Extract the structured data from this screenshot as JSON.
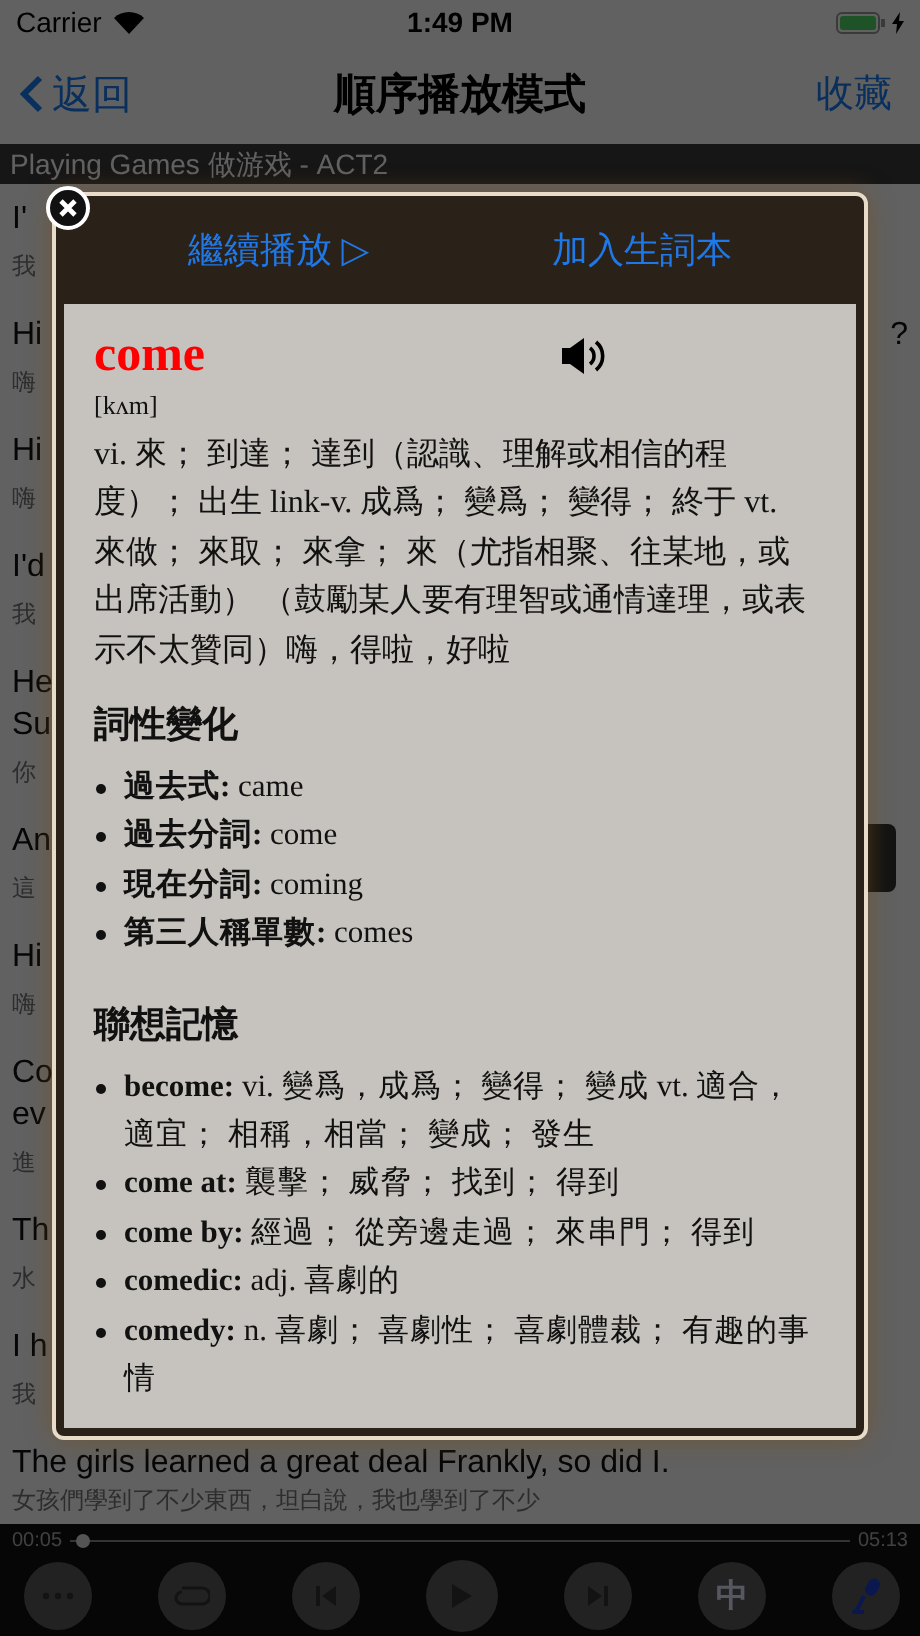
{
  "status_bar": {
    "carrier": "Carrier",
    "time": "1:49 PM"
  },
  "nav": {
    "back": "返回",
    "title": "順序播放模式",
    "action": "收藏"
  },
  "subtitle": "Playing Games 做游戏 - ACT2",
  "transcript": [
    {
      "lines": [
        "I'"
      ],
      "translation": "我"
    },
    {
      "lines": [
        "Hi"
      ],
      "translation": "嗨",
      "tail": "?"
    },
    {
      "lines": [
        "Hi"
      ],
      "translation": "嗨"
    },
    {
      "lines": [
        "I'd"
      ],
      "translation": "我"
    },
    {
      "lines": [
        "He",
        "Su"
      ],
      "translation": "你"
    },
    {
      "lines": [
        "An"
      ],
      "translation": "這"
    },
    {
      "lines": [
        "Hi"
      ],
      "translation": "嗨"
    },
    {
      "lines": [
        "Co",
        "ev"
      ],
      "translation": "進"
    },
    {
      "lines": [
        "Th"
      ],
      "translation": "水"
    },
    {
      "lines": [
        "I h"
      ],
      "translation": "我"
    },
    {
      "lines": [
        "The girls learned a great deal Frankly, so did I."
      ],
      "translation": "女孩們學到了不少東西，坦白說，我也學到了不少"
    }
  ],
  "popup": {
    "actions": [
      "繼續播放 ▷",
      "加入生詞本"
    ],
    "entry": {
      "word": "come",
      "phonetic": "[kʌm]",
      "definition": "vi. 來； 到達； 達到（認識、理解或相信的程度）； 出生 link-v. 成爲； 變爲； 變得； 終于 vt. 來做； 來取； 來拿； 來（尤指相聚、往某地，或出席活動） （鼓勵某人要有理智或通情達理，或表示不太贊同）嗨，得啦，好啦",
      "sections": [
        {
          "heading": "詞性變化",
          "items": [
            "**過去式:** came",
            "**過去分詞:** come",
            "**現在分詞:** coming",
            "**第三人稱單數:** comes"
          ]
        },
        {
          "heading": "聯想記憶",
          "items": [
            "**become:** vi. 變爲，成爲； 變得； 變成 vt. 適合，適宜； 相稱，相當； 變成； 發生",
            "**come at:** 襲擊； 威脅； 找到； 得到",
            "**come by:** 經過； 從旁邊走過； 來串門； 得到",
            "**comedic:** adj. 喜劇的",
            "**comedy:** n. 喜劇； 喜劇性； 喜劇體裁； 有趣的事情"
          ]
        }
      ]
    }
  },
  "player": {
    "elapsed": "00:05",
    "duration": "05:13",
    "level": 0.016,
    "buttons": [
      {
        "kind": "more"
      },
      {
        "kind": "loop"
      },
      {
        "kind": "previous"
      },
      {
        "kind": "play"
      },
      {
        "kind": "next"
      },
      {
        "kind": "text",
        "label": "中"
      },
      {
        "kind": "mic"
      }
    ]
  }
}
